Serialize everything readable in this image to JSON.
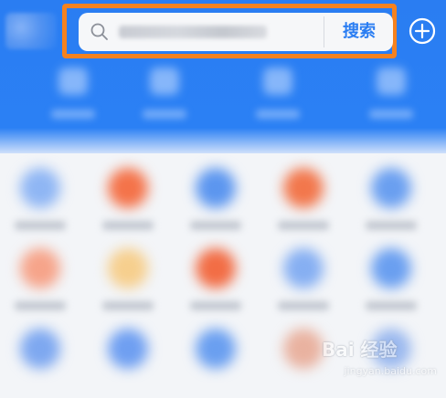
{
  "colors": {
    "header_blue": "#2b80f4",
    "accent_blue": "#2a7df2",
    "highlight_orange": "#f5821f",
    "search_bg": "#f6f7f9"
  },
  "header": {
    "search": {
      "icon": "search-icon",
      "value": "",
      "button_label": "搜索"
    },
    "add_icon": "plus-circle-icon"
  },
  "app_grid": {
    "rows": [
      [
        "#8fb6f4",
        "#f4734a",
        "#5c96ef",
        "#f2774c",
        "#6a9ff0"
      ],
      [
        "#f6a48a",
        "#f6cf8e",
        "#f26d45",
        "#86aff2",
        "#6a9ff0"
      ],
      [
        "#7ea8f0",
        "#6f9ff1",
        "#6a9ff0",
        "#e9b2a0",
        "#9ab8ee"
      ]
    ]
  },
  "watermark": {
    "logo": "Bai 经验",
    "url": "jingyan.baidu.com"
  }
}
